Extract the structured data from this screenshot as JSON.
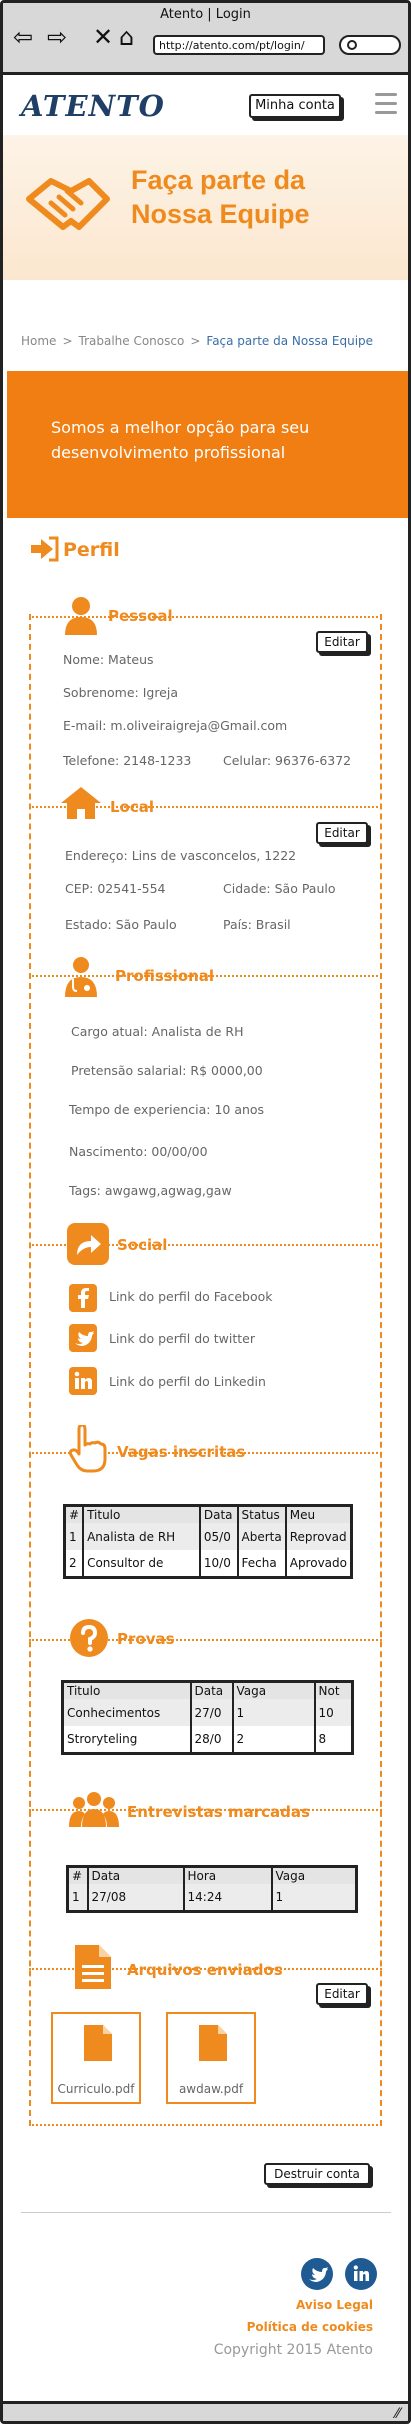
{
  "browser": {
    "title": "Atento | Login",
    "url": "http://atento.com/pt/login/"
  },
  "header": {
    "logo": "ATENTO",
    "account_button": "Minha conta"
  },
  "hero": {
    "title": "Faça parte da Nossa Equipe"
  },
  "breadcrumb": {
    "items": [
      "Home",
      "Trabalhe Conosco",
      "Faça parte da Nossa Equipe"
    ]
  },
  "banner": {
    "text": "Somos a melhor opção para seu desenvolvimento profissional"
  },
  "profile": {
    "title": "Perfil",
    "personal": {
      "title": "Pessoal",
      "edit": "Editar",
      "name": "Nome: Mateus",
      "surname": "Sobrenome: Igreja",
      "email": "E-mail: m.oliveiraigreja@Gmail.com",
      "phone": "Telefone: 2148-1233",
      "mobile": "Celular: 96376-6372"
    },
    "location": {
      "title": "Local",
      "edit": "Editar",
      "address": "Endereço: Lins de vasconcelos, 1222",
      "zip": "CEP: 02541-554",
      "city": "Cidade: São Paulo",
      "state": "Estado: São Paulo",
      "country": "País: Brasil"
    },
    "professional": {
      "title": "Profissional",
      "role": "Cargo atual: Analista de RH",
      "salary": "Pretensão salarial: R$ 0000,00",
      "experience": "Tempo de experiencia: 10 anos",
      "birth": "Nascimento: 00/00/00",
      "tags": "Tags: awgawg,agwag,gaw"
    },
    "social": {
      "title": "Social",
      "facebook": "Link do perfil do Facebook",
      "twitter": "Link do perfil do twitter",
      "linkedin": "Link do perfil do Linkedin"
    },
    "applications": {
      "title": "Vagas inscritas",
      "headers": [
        "#",
        "Titulo",
        "Data",
        "Status",
        "Meu"
      ],
      "rows": [
        [
          "1",
          "Analista de RH",
          "05/0",
          "Aberta",
          "Reprovad"
        ],
        [
          "2",
          "Consultor de",
          "10/0",
          "Fecha",
          "Aprovado"
        ]
      ]
    },
    "tests": {
      "title": "Provas",
      "headers": [
        "Titulo",
        "Data",
        "Vaga",
        "Not"
      ],
      "rows": [
        [
          "Conhecimentos",
          "27/0",
          "1",
          "10"
        ],
        [
          "Stroryteling",
          "28/0",
          "2",
          "8"
        ]
      ]
    },
    "interviews": {
      "title": "Entrevistas marcadas",
      "headers": [
        "#",
        "Data",
        "Hora",
        "Vaga"
      ],
      "rows": [
        [
          "1",
          "27/08",
          "14:24",
          "1"
        ]
      ]
    },
    "files": {
      "title": "Arquivos enviados",
      "edit": "Editar",
      "items": [
        "Curriculo.pdf",
        "awdaw.pdf"
      ]
    }
  },
  "actions": {
    "destroy": "Destruir conta"
  },
  "footer": {
    "legal": "Aviso Legal",
    "cookies": "Política de cookies",
    "copyright": "Copyright 2015 Atento"
  },
  "colors": {
    "accent": "#ef8a1e",
    "brand": "#1f3f66",
    "banner": "#f07e12",
    "social": "#1f5a93"
  }
}
